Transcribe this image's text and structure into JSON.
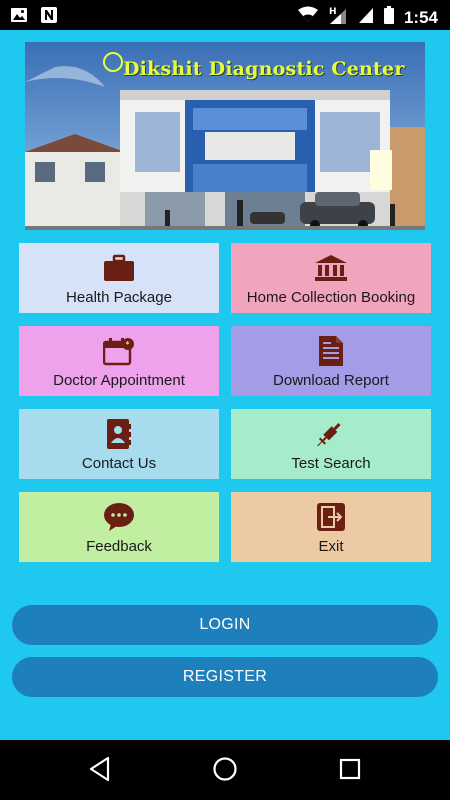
{
  "status_bar": {
    "time": "1:54"
  },
  "banner": {
    "title": "Dikshit Diagnostic Center"
  },
  "colors": {
    "background": "#1ec8ef",
    "icon": "#6b1f12",
    "button": "#1e7fbd"
  },
  "tiles": [
    {
      "label": "Health Package",
      "icon": "briefcase-icon",
      "color": "#d6e2f7"
    },
    {
      "label": "Home Collection Booking",
      "icon": "bank-icon",
      "color": "#f1a4be"
    },
    {
      "label": "Doctor Appointment",
      "icon": "calendar-icon",
      "color": "#eea2ec"
    },
    {
      "label": "Download Report",
      "icon": "document-icon",
      "color": "#a49ce6"
    },
    {
      "label": "Contact Us",
      "icon": "contacts-icon",
      "color": "#a6dcee"
    },
    {
      "label": "Test Search",
      "icon": "syringe-icon",
      "color": "#a6eccb"
    },
    {
      "label": "Feedback",
      "icon": "chat-icon",
      "color": "#c2eea2"
    },
    {
      "label": "Exit",
      "icon": "exit-icon",
      "color": "#eccba4"
    }
  ],
  "buttons": {
    "login": "LOGIN",
    "register": "REGISTER"
  }
}
